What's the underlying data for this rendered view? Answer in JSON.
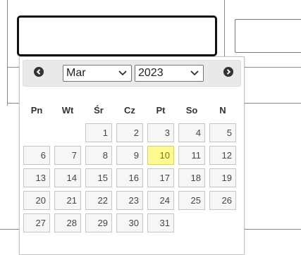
{
  "datepicker": {
    "month_select": {
      "value": "Mar",
      "options": [
        "Mar"
      ]
    },
    "year_select": {
      "value": "2023",
      "options": [
        "2023"
      ]
    },
    "weekdays": [
      "Pn",
      "Wt",
      "Śr",
      "Cz",
      "Pt",
      "So",
      "N"
    ],
    "weeks": [
      [
        null,
        null,
        "1",
        "2",
        "3",
        "4",
        "5"
      ],
      [
        "6",
        "7",
        "8",
        "9",
        "10",
        "11",
        "12"
      ],
      [
        "13",
        "14",
        "15",
        "16",
        "17",
        "18",
        "19"
      ],
      [
        "20",
        "21",
        "22",
        "23",
        "24",
        "25",
        "26"
      ],
      [
        "27",
        "28",
        "29",
        "30",
        "31",
        null,
        null
      ]
    ],
    "highlighted_day": "10",
    "icons": {
      "prev": "circle-arrow-left-icon",
      "next": "circle-arrow-right-icon"
    },
    "colors": {
      "highlight": "#fffa90",
      "header": "#e9e9e9"
    }
  }
}
